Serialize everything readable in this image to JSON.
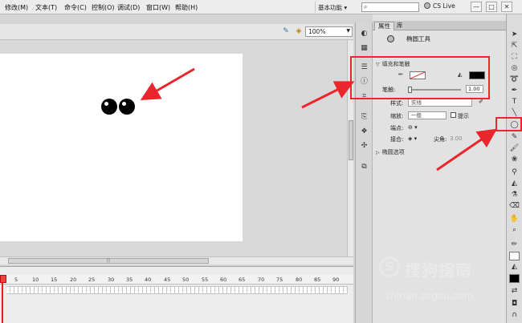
{
  "menubar": {
    "items": [
      {
        "label": "修改(M)"
      },
      {
        "label": "文本(T)"
      },
      {
        "label": "命令(C)"
      },
      {
        "label": "控制(O)"
      },
      {
        "label": "调试(D)"
      },
      {
        "label": "窗口(W)"
      },
      {
        "label": "帮助(H)"
      }
    ],
    "workspace_label": "基本功能 ▾",
    "search_placeholder": "",
    "cs_live_label": "CS Live",
    "window_buttons": [
      "—",
      "□",
      "✕"
    ]
  },
  "stage_toolbar": {
    "zoom_value": "100%",
    "icons": [
      "edit-scene-icon",
      "edit-symbol-icon"
    ]
  },
  "stage": {
    "eyes_color": "#000000"
  },
  "timeline": {
    "frame_numbers": [
      "1",
      "5",
      "10",
      "15",
      "20",
      "25",
      "30",
      "35",
      "40",
      "45",
      "50",
      "55",
      "60",
      "65",
      "70",
      "75",
      "80",
      "85",
      "90"
    ],
    "scroll_thumb": "|||"
  },
  "properties": {
    "tabs": [
      {
        "label": "属性"
      },
      {
        "label": "库"
      }
    ],
    "tool_name": "椭圆工具",
    "fill_stroke_section": "填充和笔触",
    "stroke_label": "笔触:",
    "stroke_value": "1.00",
    "style_label": "样式:",
    "style_value": "实线",
    "scale_label": "缩放:",
    "scale_value": "一般",
    "hint_label": "提示",
    "cap_label": "端点:",
    "join_label": "接合:",
    "miter_label": "尖角:",
    "miter_value": "3.00",
    "ellipse_options_section": "椭圆选项",
    "stroke_color": "#ffffff",
    "fill_color": "#000000"
  },
  "watermark": {
    "logo": "S",
    "text": "搜狗指南",
    "url": "zhinan.sogou.com"
  },
  "colors": {
    "annotation_red": "#e8262b"
  }
}
